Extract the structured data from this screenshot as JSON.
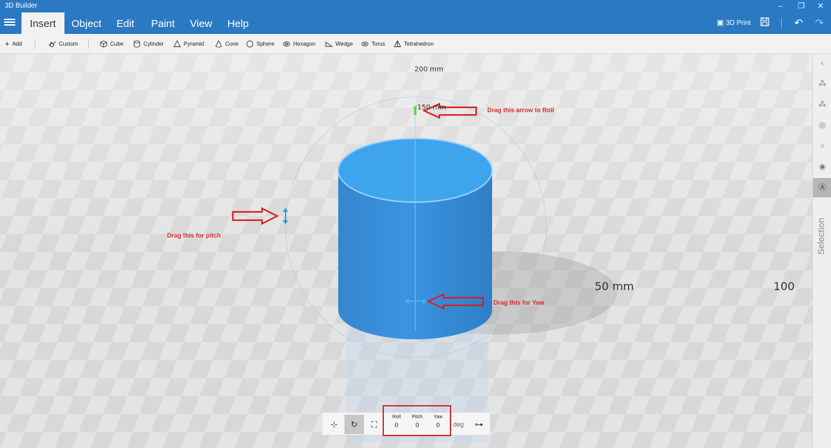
{
  "window": {
    "title": "3D Builder"
  },
  "ribbon": {
    "tabs": [
      "Insert",
      "Object",
      "Edit",
      "Paint",
      "View",
      "Help"
    ],
    "active_tab": "Insert",
    "print_label": "3D Print"
  },
  "toolbar": {
    "add": "Add",
    "custom": "Custom",
    "shapes": [
      "Cube",
      "Cylinder",
      "Pyramid",
      "Cone",
      "Sphere",
      "Hexagon",
      "Wedge",
      "Torus",
      "Tetrahedron"
    ]
  },
  "viewport": {
    "scale_labels": {
      "top": "200 mm",
      "mid": "150 mm",
      "right_near": "50 mm",
      "right_far": "100"
    },
    "object_color": "#3a9ee8",
    "annotations": {
      "roll": "Drag this arrow to Roll",
      "pitch": "Drag this for pitch",
      "yaw": "Drag this for Yaw"
    }
  },
  "right_panel": {
    "label": "Selection"
  },
  "transform": {
    "roll_label": "Roll",
    "roll_value": "0",
    "pitch_label": "Pitch",
    "pitch_value": "0",
    "yaw_label": "Yaw",
    "yaw_value": "0",
    "unit": "deg"
  }
}
